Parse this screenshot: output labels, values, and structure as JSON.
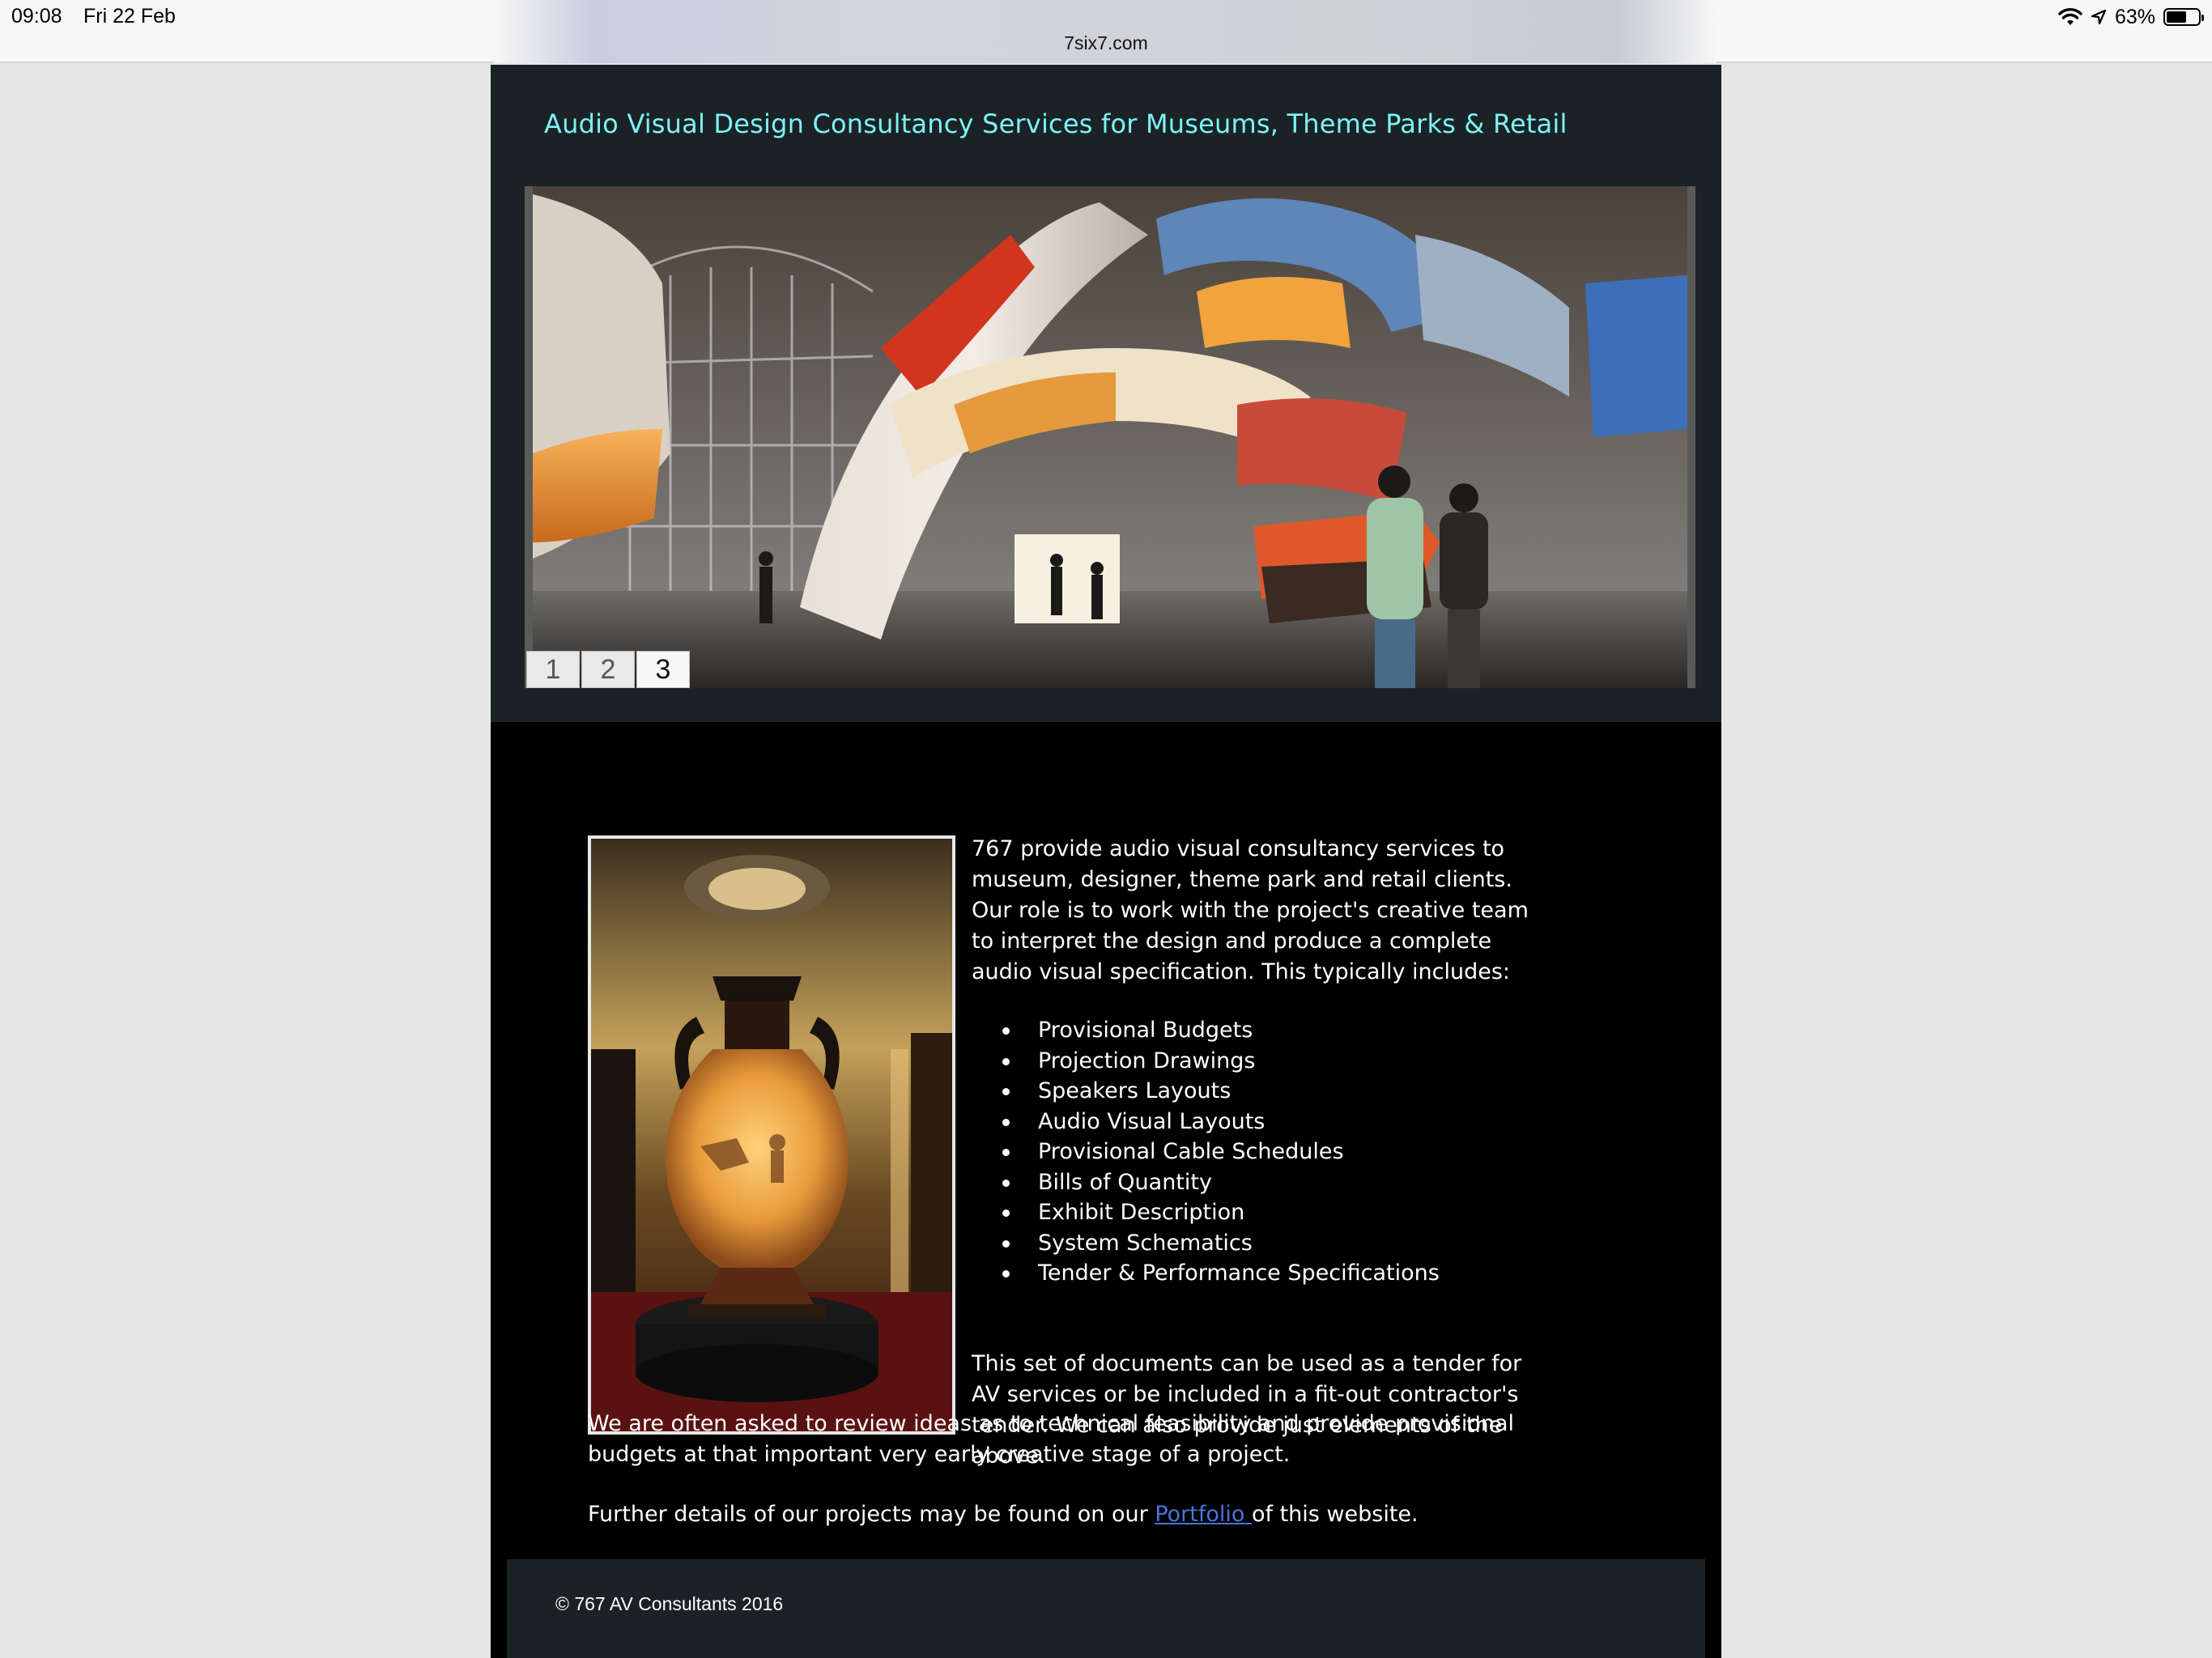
{
  "status_bar": {
    "time": "09:08",
    "date": "Fri 22 Feb",
    "url": "7six7.com",
    "battery": "63%",
    "battery_level": 0.63
  },
  "header": {
    "title": "Audio Visual Design Consultancy Services for Museums, Theme Parks & Retail",
    "slides": [
      "1",
      "2",
      "3"
    ],
    "active_slide": "3"
  },
  "content": {
    "intro": "767 provide audio visual consultancy services to museum, designer, theme park and retail clients.  Our role is to work with the project's creative team to interpret the design and produce a complete audio visual specification.  This typically includes:",
    "services": [
      "Provisional Budgets",
      "Projection Drawings",
      "Speakers Layouts",
      "Audio Visual Layouts",
      "Provisional Cable Schedules",
      "Bills of Quantity",
      "Exhibit Description",
      "System Schematics",
      "Tender & Performance Specifications"
    ],
    "tender": "This set of documents can be used as a tender for AV services or be included in a fit-out contractor's tender.  We can also provide just elements of the above.",
    "review": "We are often asked to review ideas as to technical feasibility and provide provisional budgets at that important very early creative stage of a project.",
    "further_before": "Further details of our projects may be found on our ",
    "further_link": "Portfolio ",
    "further_after": "of this website."
  },
  "footer": {
    "copyright": "© 767 AV Consultants 2016"
  },
  "colors": {
    "title": "#7cf3f6",
    "header_bg": "#1b2226",
    "body_bg": "#000000",
    "link": "#4a74d9"
  }
}
